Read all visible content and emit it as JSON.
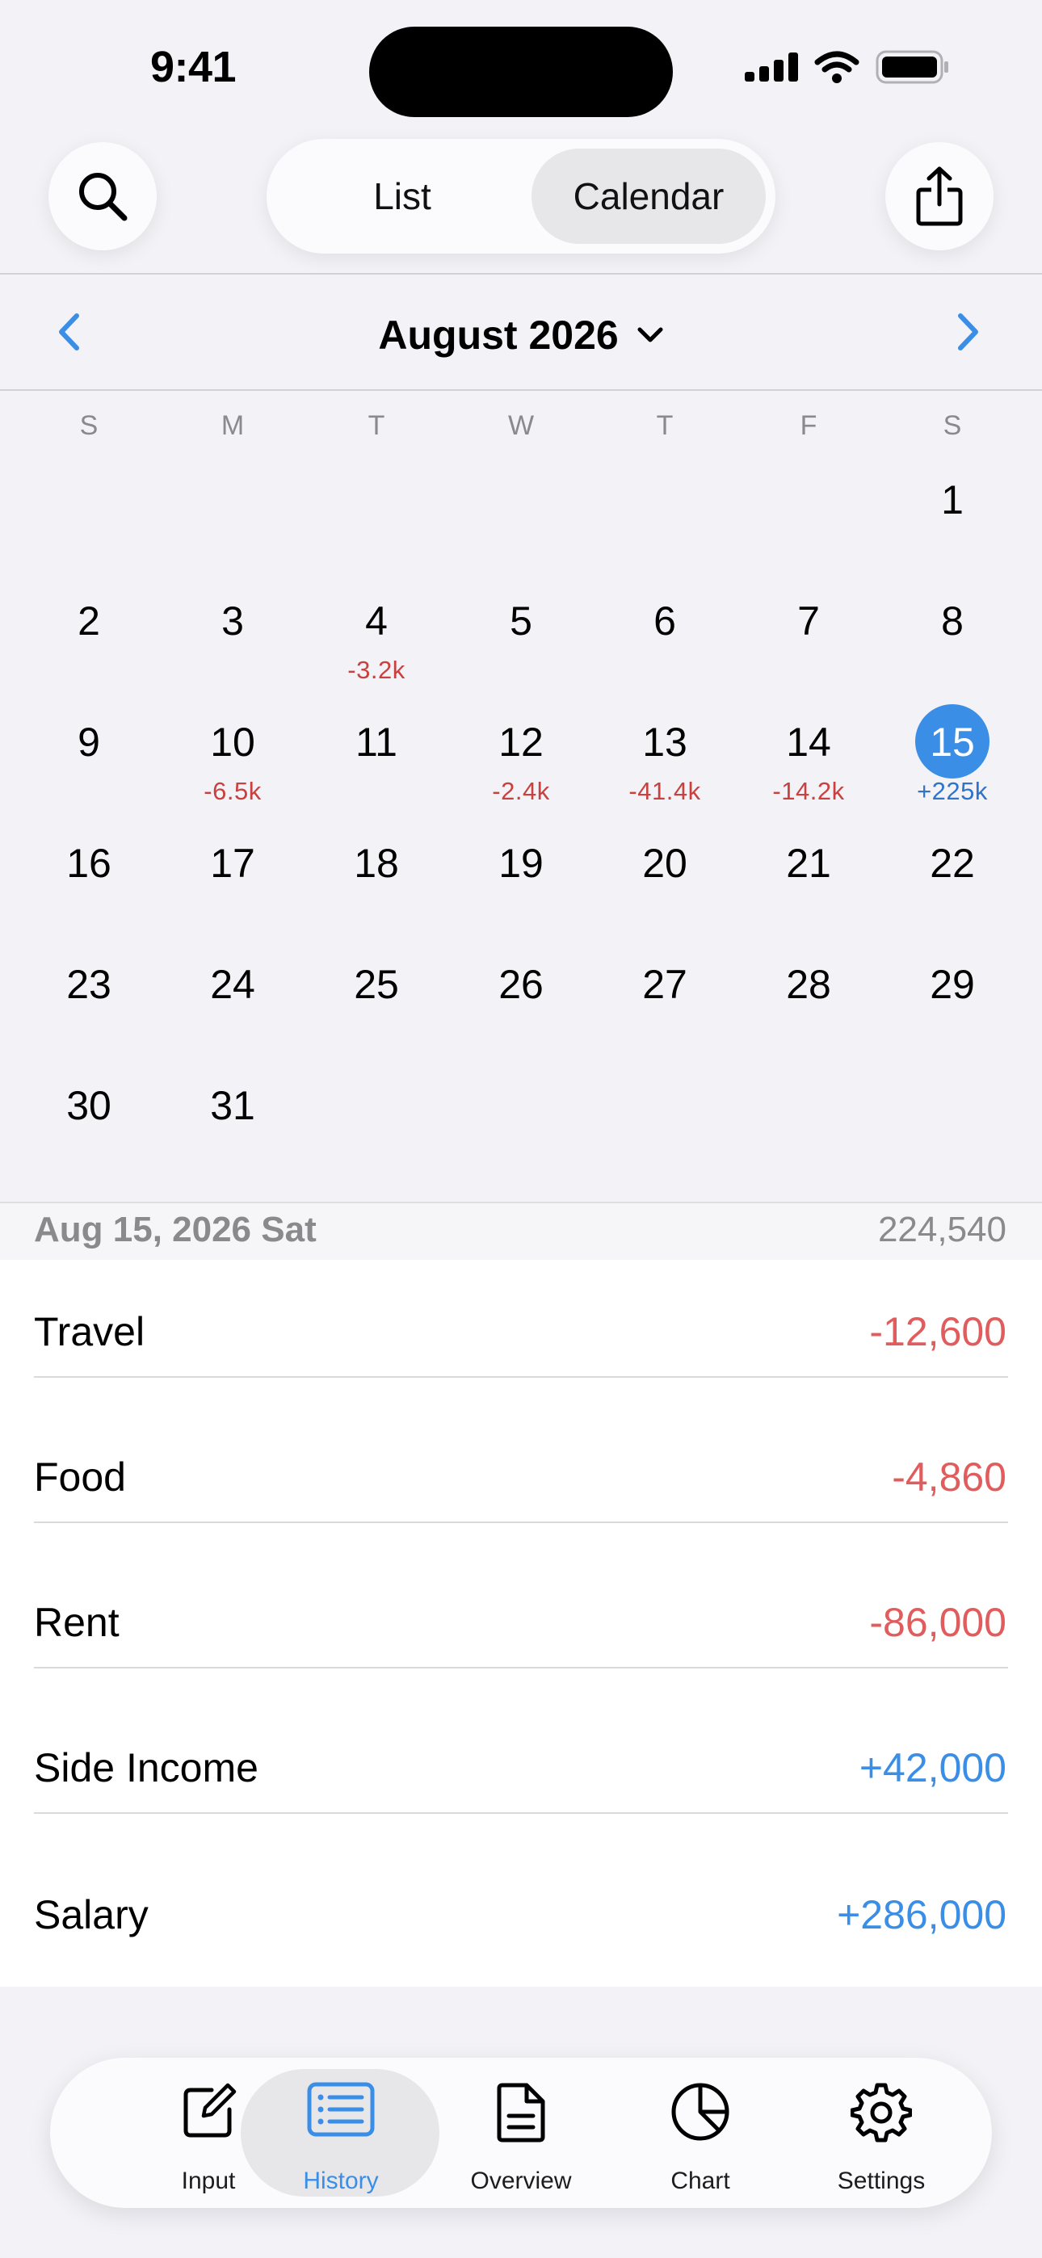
{
  "status_bar": {
    "time": "9:41"
  },
  "top_bar": {
    "search_icon": "search-icon",
    "segments": {
      "list": "List",
      "calendar": "Calendar",
      "selected": "Calendar"
    },
    "share_icon": "share-icon"
  },
  "month_nav": {
    "title": "August 2026"
  },
  "weekdays": [
    "S",
    "M",
    "T",
    "W",
    "T",
    "F",
    "S"
  ],
  "calendar": {
    "days": [
      "1",
      "2",
      "3",
      "4",
      "5",
      "6",
      "7",
      "8",
      "9",
      "10",
      "11",
      "12",
      "13",
      "14",
      "15",
      "16",
      "17",
      "18",
      "19",
      "20",
      "21",
      "22",
      "23",
      "24",
      "25",
      "26",
      "27",
      "28",
      "29",
      "30",
      "31"
    ],
    "selected_day": "15",
    "amounts": {
      "4": "-3.2k",
      "10": "-6.5k",
      "12": "-2.4k",
      "13": "-41.4k",
      "14": "-14.2k",
      "15": "+225k"
    }
  },
  "detail": {
    "date": "Aug 15, 2026 Sat",
    "total": "224,540",
    "items": [
      {
        "label": "Travel",
        "amount": "-12,600"
      },
      {
        "label": "Food",
        "amount": "-4,860"
      },
      {
        "label": "Rent",
        "amount": "-86,000"
      },
      {
        "label": "Side Income",
        "amount": "+42,000"
      },
      {
        "label": "Salary",
        "amount": "+286,000"
      }
    ]
  },
  "tab_bar": {
    "tabs": [
      {
        "label": "Input",
        "icon": "edit-icon"
      },
      {
        "label": "History",
        "icon": "list-icon"
      },
      {
        "label": "Overview",
        "icon": "document-icon"
      },
      {
        "label": "Chart",
        "icon": "pie-chart-icon"
      },
      {
        "label": "Settings",
        "icon": "gear-icon"
      }
    ],
    "active": "History"
  },
  "colors": {
    "accent": "#3a8ee6",
    "negative": "#e15c5c",
    "calendar_negative": "#c8413f",
    "calendar_positive": "#2f74c9"
  }
}
